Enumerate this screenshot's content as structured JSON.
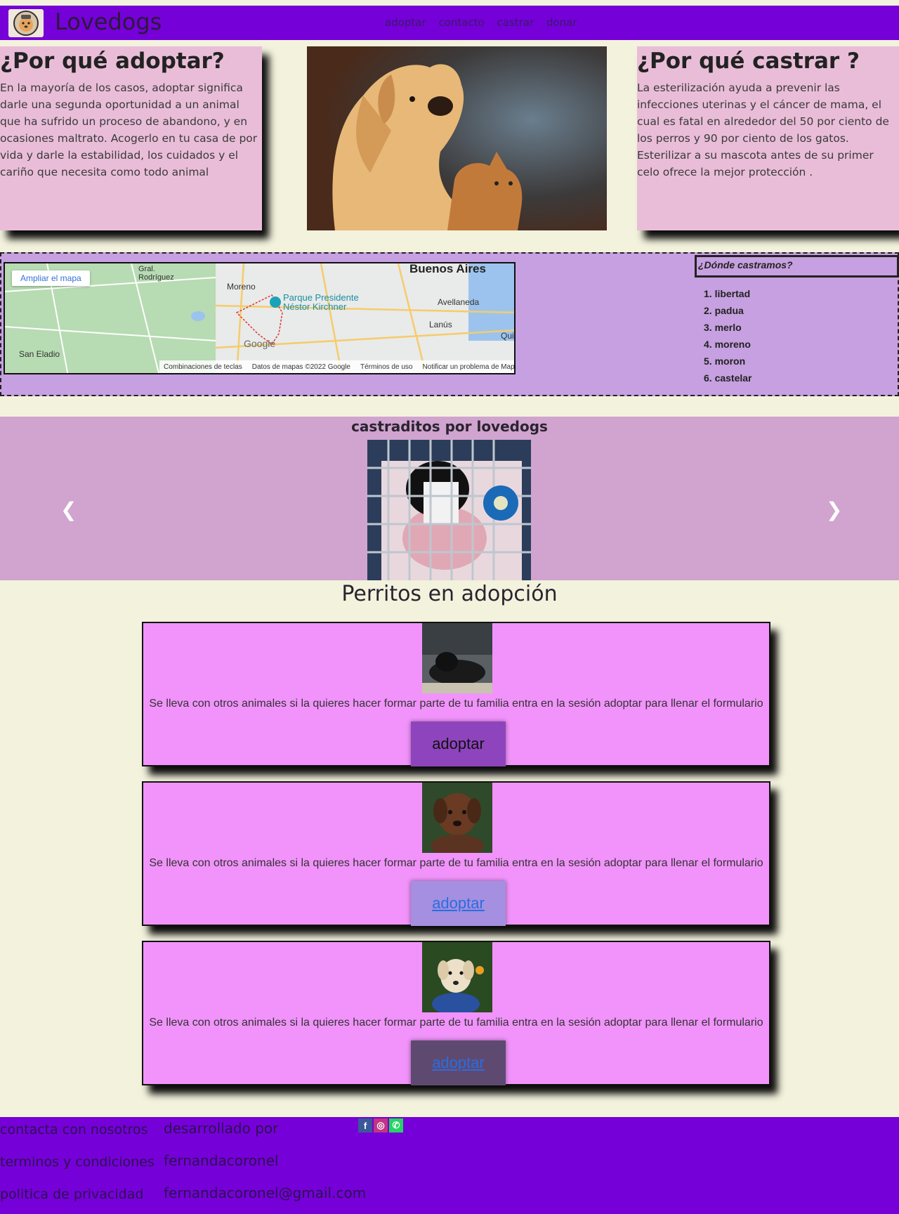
{
  "header": {
    "brand": "Lovedogs",
    "nav": [
      "adoptar",
      "contacto",
      "castrar",
      "donar"
    ]
  },
  "adopt_info": {
    "title": "¿Por qué adoptar?",
    "text": "En la mayoría de los casos, adoptar significa darle una segunda oportunidad a un animal que ha sufrido un proceso de abandono, y en ocasiones maltrato. Acogerlo en tu casa de por vida y darle la estabilidad, los cuidados y el cariño que necesita como todo animal"
  },
  "castrate_info": {
    "title": "¿Por qué castrar ?",
    "text": "La esterilización ayuda a prevenir las infecciones uterinas y el cáncer de mama, el cual es fatal en alrededor del 50 por ciento de los perros y 90 por ciento de los gatos. Esterilizar a su mascota antes de su primer celo ofrece la mejor protección ."
  },
  "map": {
    "expand_button": "Ampliar el mapa",
    "labels": {
      "city": "Buenos Aires",
      "place": "Parque Presidente Néstor Kirchner",
      "moreno": "Moreno",
      "rodriguez": "Gral. Rodríguez",
      "avellaneda": "Avellaneda",
      "lanus": "Lanús",
      "san_eladio": "San Eladio",
      "quilmes": "Quil",
      "google": "Google"
    },
    "footer": [
      "Combinaciones de teclas",
      "Datos de mapas ©2022 Google",
      "Términos de uso",
      "Notificar un problema de Maps"
    ]
  },
  "where": {
    "title": "¿Dónde castramos?",
    "places": [
      "1. libertad",
      "2. padua",
      "3. merlo",
      "4. moreno",
      "5. moron",
      "6. castelar"
    ]
  },
  "carousel": {
    "title": "castraditos por lovedogs"
  },
  "adoption": {
    "title": "Perritos en adopción",
    "dogs": [
      {
        "desc": "Se lleva con otros animales si la quieres hacer formar parte de tu familia entra en la sesión adoptar para llenar el formulario",
        "button": "adoptar",
        "button_bg": "#8e44bd",
        "button_color": "#111111"
      },
      {
        "desc": "Se lleva con otros animales si la quieres hacer formar parte de tu familia entra en la sesión adoptar para llenar el formulario",
        "button": "adoptar",
        "button_bg": "#a48fe0",
        "button_color": "#2a6de0"
      },
      {
        "desc": "Se lleva con otros animales si la quieres hacer formar parte de tu familia entra en la sesión adoptar para llenar el formulario",
        "button": "adoptar",
        "button_bg": "#5e4a70",
        "button_color": "#2a6de0"
      }
    ]
  },
  "footer": {
    "links": [
      "contacta con nosotros",
      "terminos y condiciones",
      "politica de privacidad"
    ],
    "credits": [
      "desarrollado por",
      "fernandacoronel",
      "fernandacoronel@gmail.com"
    ],
    "social": [
      "facebook-icon",
      "instagram-icon",
      "whatsapp-icon"
    ]
  },
  "colors": {
    "nav": "#7500d8",
    "info_card": "#e9bdd8",
    "map_strip": "#c6a0e0",
    "carousel": "#d0a4cf",
    "dog_card": "#f193fb",
    "page": "#f3f2dd"
  }
}
